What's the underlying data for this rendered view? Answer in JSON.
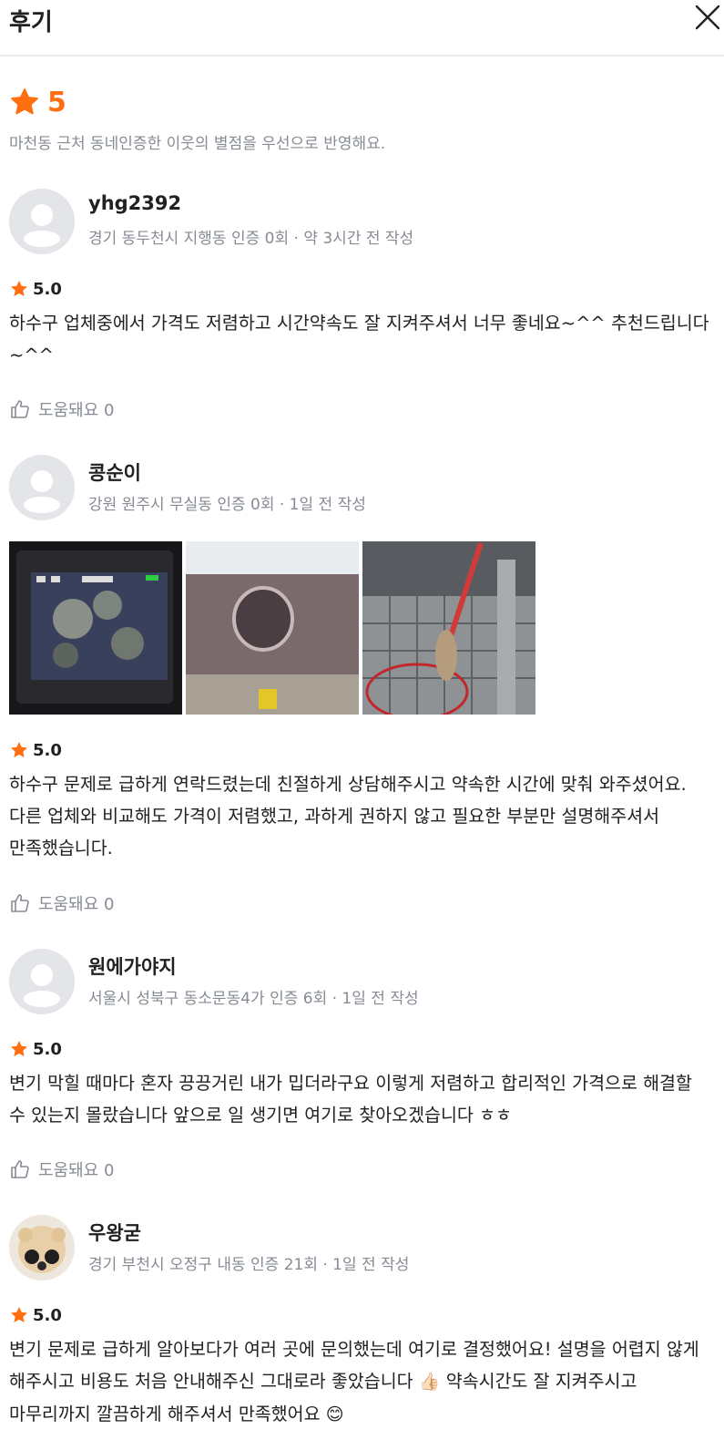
{
  "header": {
    "title": "후기"
  },
  "summary": {
    "score": "5",
    "note": "마천동 근처 동네인증한 이웃의 별점을 우선으로 반영해요."
  },
  "colors": {
    "accent": "#ff6f0f",
    "muted": "#868b94",
    "text": "#212124"
  },
  "icons": [
    "close-icon",
    "star-icon",
    "thumbs-up-icon",
    "default-avatar-icon"
  ],
  "reviews": [
    {
      "author": "yhg2392",
      "meta": "경기 동두천시 지행동 인증 0회 · 약 3시간 전 작성",
      "rating": "5.0",
      "text": "하수구 업체중에서 가격도 저렴하고 시간약속도 잘 지켜주셔서 너무 좋네요~^^ 추천드립니다~^^",
      "helpful": "도움돼요 0"
    },
    {
      "author": "콩순이",
      "meta": "강원 원주시 무실동 인증 0회 · 1일 전 작성",
      "rating": "5.0",
      "text": "하수구 문제로 급하게 연락드렸는데 친절하게 상담해주시고 약속한 시간에 맞춰 와주셨어요. 다른 업체와 비교해도 가격이 저렴했고, 과하게 권하지 않고 필요한 부분만 설명해주셔서 만족했습니다.",
      "helpful": "도움돼요 0",
      "photo_count": 3
    },
    {
      "author": "원에가야지",
      "meta": "서울시 성북구 동소문동4가 인증 6회 · 1일 전 작성",
      "rating": "5.0",
      "text": "변기 막힐 때마다 혼자 끙끙거린 내가 밉더라구요 이렇게 저렴하고 합리적인 가격으로 해결할 수 있는지 몰랐습니다 앞으로 일 생기면 여기로 찾아오겠습니다 ㅎㅎ",
      "helpful": "도움돼요 0"
    },
    {
      "author": "우왕굳",
      "meta": "경기 부천시 오정구 내동 인증 21회 · 1일 전 작성",
      "rating": "5.0",
      "text_1": "변기 문제로 급하게 알아보다가 여러 곳에 문의했는데 여기로 결정했어요! 설명을 어렵지 않게 해주시고 비용도 처음 안내해주신 그대로라 좋았습니다",
      "emoji_1": "👍🏻",
      "text_2": "약속시간도 잘 지켜주시고 마무리까지 깔끔하게 해주셔서 만족했어요",
      "emoji_2": "😊"
    }
  ]
}
